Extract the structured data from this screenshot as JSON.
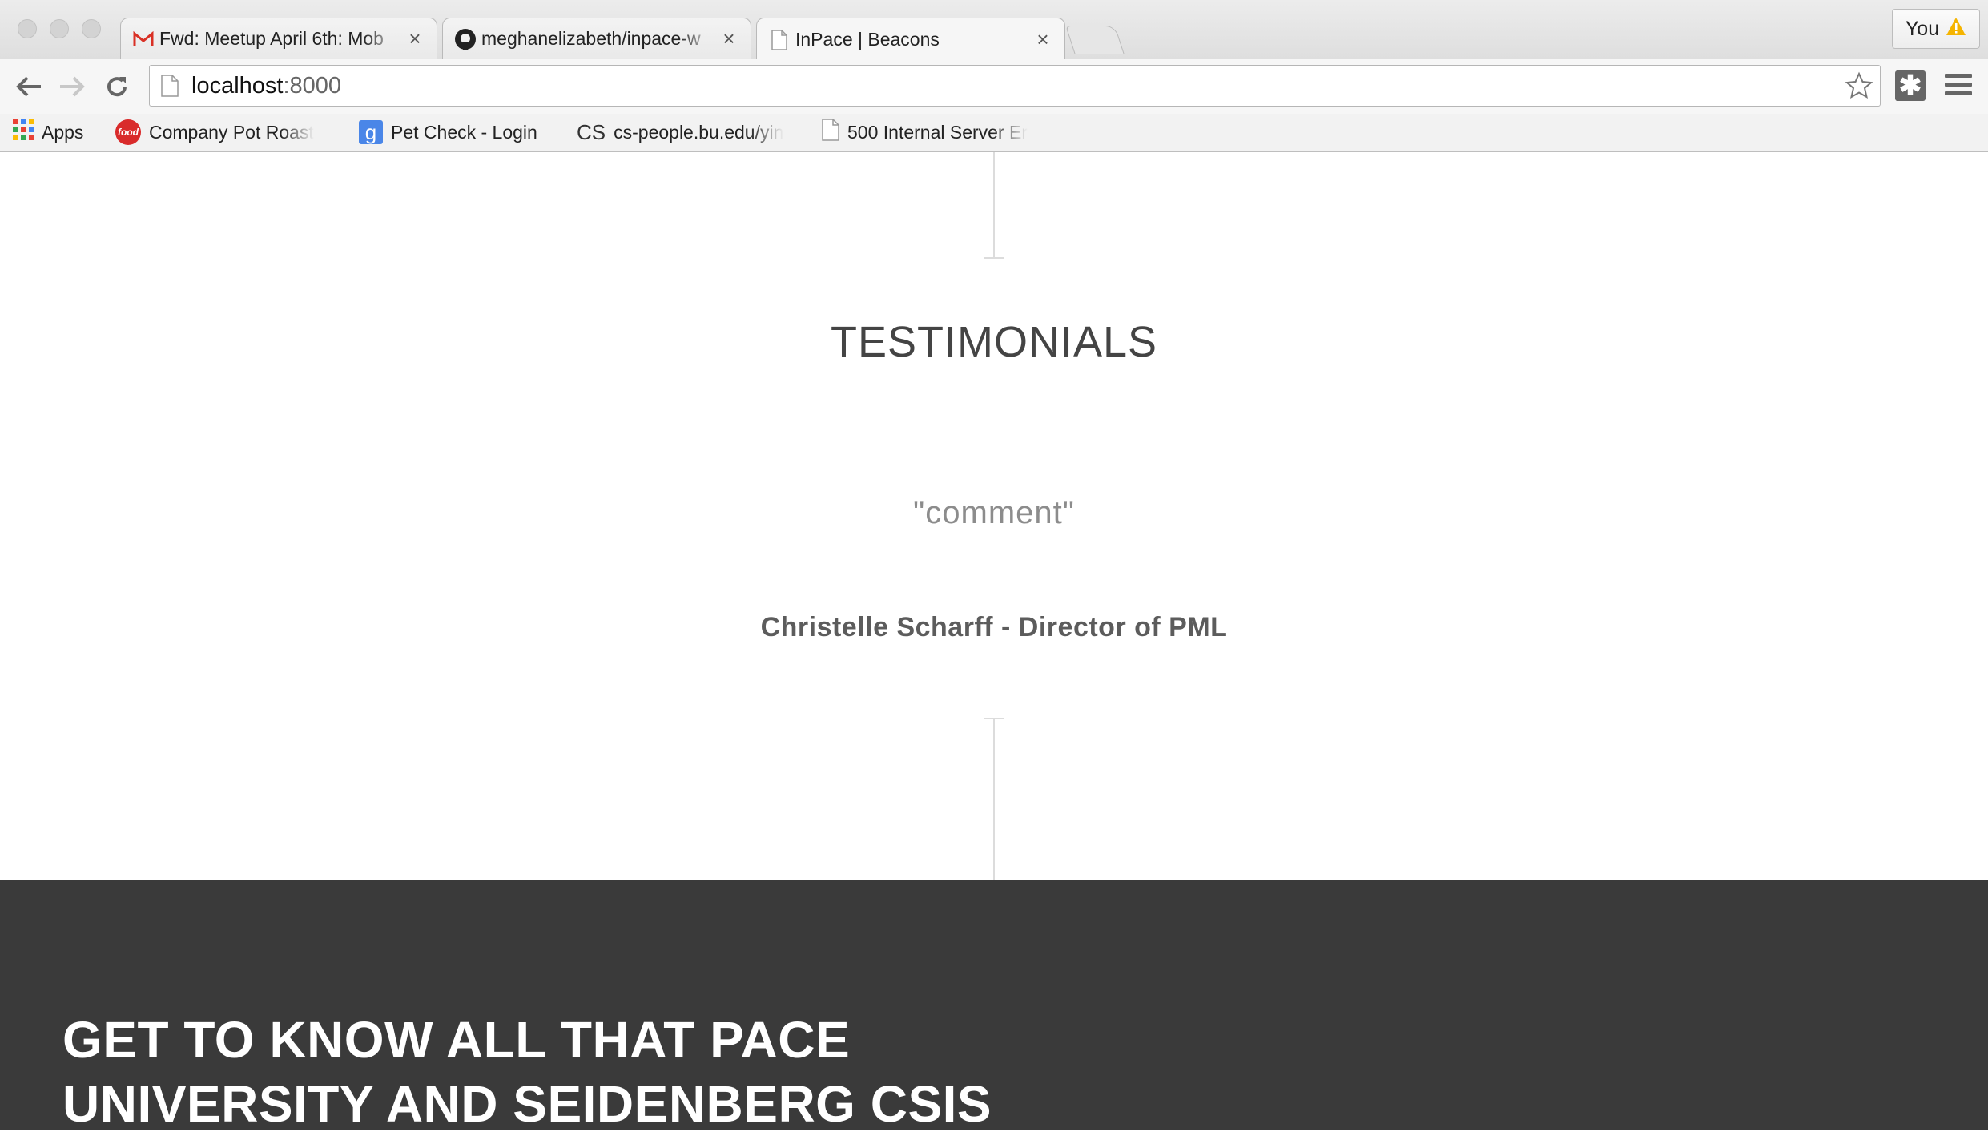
{
  "browser": {
    "tabs": [
      {
        "title": "Fwd: Meetup April 6th: Mob",
        "icon": "gmail-icon",
        "active": false
      },
      {
        "title": "meghanelizabeth/inpace-w",
        "icon": "github-icon",
        "active": false
      },
      {
        "title": "InPace | Beacons",
        "icon": "page-icon",
        "active": true
      }
    ],
    "close_glyph": "×",
    "profile_label": "You",
    "address": {
      "host": "localhost",
      "port": ":8000"
    },
    "bookmarks": [
      {
        "label": "Apps",
        "icon": "apps-grid-icon"
      },
      {
        "label": "Company Pot Roast",
        "icon": "food-icon",
        "badge": "food"
      },
      {
        "label": "Pet Check - Login",
        "icon": "google-icon",
        "badge": "g"
      },
      {
        "label": "cs-people.bu.edu/yin",
        "icon": "cs-icon",
        "badge": "CS"
      },
      {
        "label": "500 Internal Server Er",
        "icon": "page-icon"
      }
    ]
  },
  "page": {
    "section_heading": "TESTIMONIALS",
    "testimonial": {
      "comment": "\"comment\"",
      "author": "Christelle Scharff - Director of PML"
    },
    "footer_heading": "GET TO KNOW ALL THAT PACE UNIVERSITY AND SEIDENBERG CSIS"
  },
  "colors": {
    "heading": "#444444",
    "comment": "#8c8c8c",
    "author": "#5c5c5c",
    "footer_bg": "#3a3a3a",
    "footer_text": "#ffffff",
    "divider": "#dcdcdc"
  }
}
